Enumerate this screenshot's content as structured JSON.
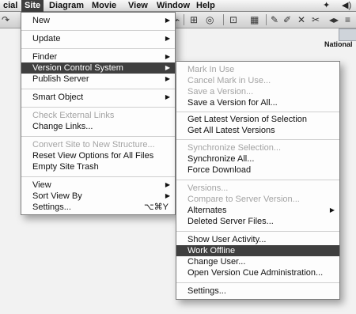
{
  "menubar": {
    "items": [
      "cial",
      "Site",
      "Diagram",
      "Movie",
      "View",
      "Window",
      "Help"
    ],
    "active": "Site"
  },
  "desktop": {
    "label": "National"
  },
  "site_menu": {
    "items": [
      {
        "label": "New",
        "submenu": true,
        "disabled": false
      },
      {
        "label": "Update",
        "submenu": true,
        "disabled": false
      },
      {
        "label": "Finder",
        "submenu": true,
        "disabled": false
      },
      {
        "label": "Version Control System",
        "submenu": true,
        "disabled": false,
        "highlight": true
      },
      {
        "label": "Publish Server",
        "submenu": true,
        "disabled": false
      },
      {
        "label": "Smart Object",
        "submenu": true,
        "disabled": false
      },
      {
        "label": "Check External Links",
        "disabled": true
      },
      {
        "label": "Change Links...",
        "disabled": false
      },
      {
        "label": "Convert Site to New Structure...",
        "disabled": true
      },
      {
        "label": "Reset View Options for All Files",
        "disabled": false
      },
      {
        "label": "Empty Site Trash",
        "disabled": false
      },
      {
        "label": "View",
        "submenu": true,
        "disabled": false
      },
      {
        "label": "Sort View By",
        "submenu": true,
        "disabled": false
      },
      {
        "label": "Settings...",
        "shortcut": "⌥⌘Y",
        "disabled": false
      }
    ]
  },
  "vcs_menu": {
    "items": [
      {
        "label": "Mark In Use",
        "disabled": true
      },
      {
        "label": "Cancel Mark in Use...",
        "disabled": true
      },
      {
        "label": "Save a Version...",
        "disabled": true
      },
      {
        "label": "Save a Version for All...",
        "disabled": false
      },
      {
        "label": "Get Latest Version of Selection",
        "disabled": false
      },
      {
        "label": "Get All Latest Versions",
        "disabled": false
      },
      {
        "label": "Synchronize Selection...",
        "disabled": true
      },
      {
        "label": "Synchronize All...",
        "disabled": false
      },
      {
        "label": "Force Download",
        "disabled": false
      },
      {
        "label": "Versions...",
        "disabled": true
      },
      {
        "label": "Compare to Server Version...",
        "disabled": true
      },
      {
        "label": "Alternates",
        "submenu": true,
        "disabled": false
      },
      {
        "label": "Deleted Server Files...",
        "disabled": false
      },
      {
        "label": "Show User Activity...",
        "disabled": false
      },
      {
        "label": "Work Offline",
        "disabled": false,
        "highlight": true
      },
      {
        "label": "Change User...",
        "disabled": false
      },
      {
        "label": "Open Version Cue Administration...",
        "disabled": false
      },
      {
        "label": "Settings...",
        "disabled": false
      }
    ]
  }
}
